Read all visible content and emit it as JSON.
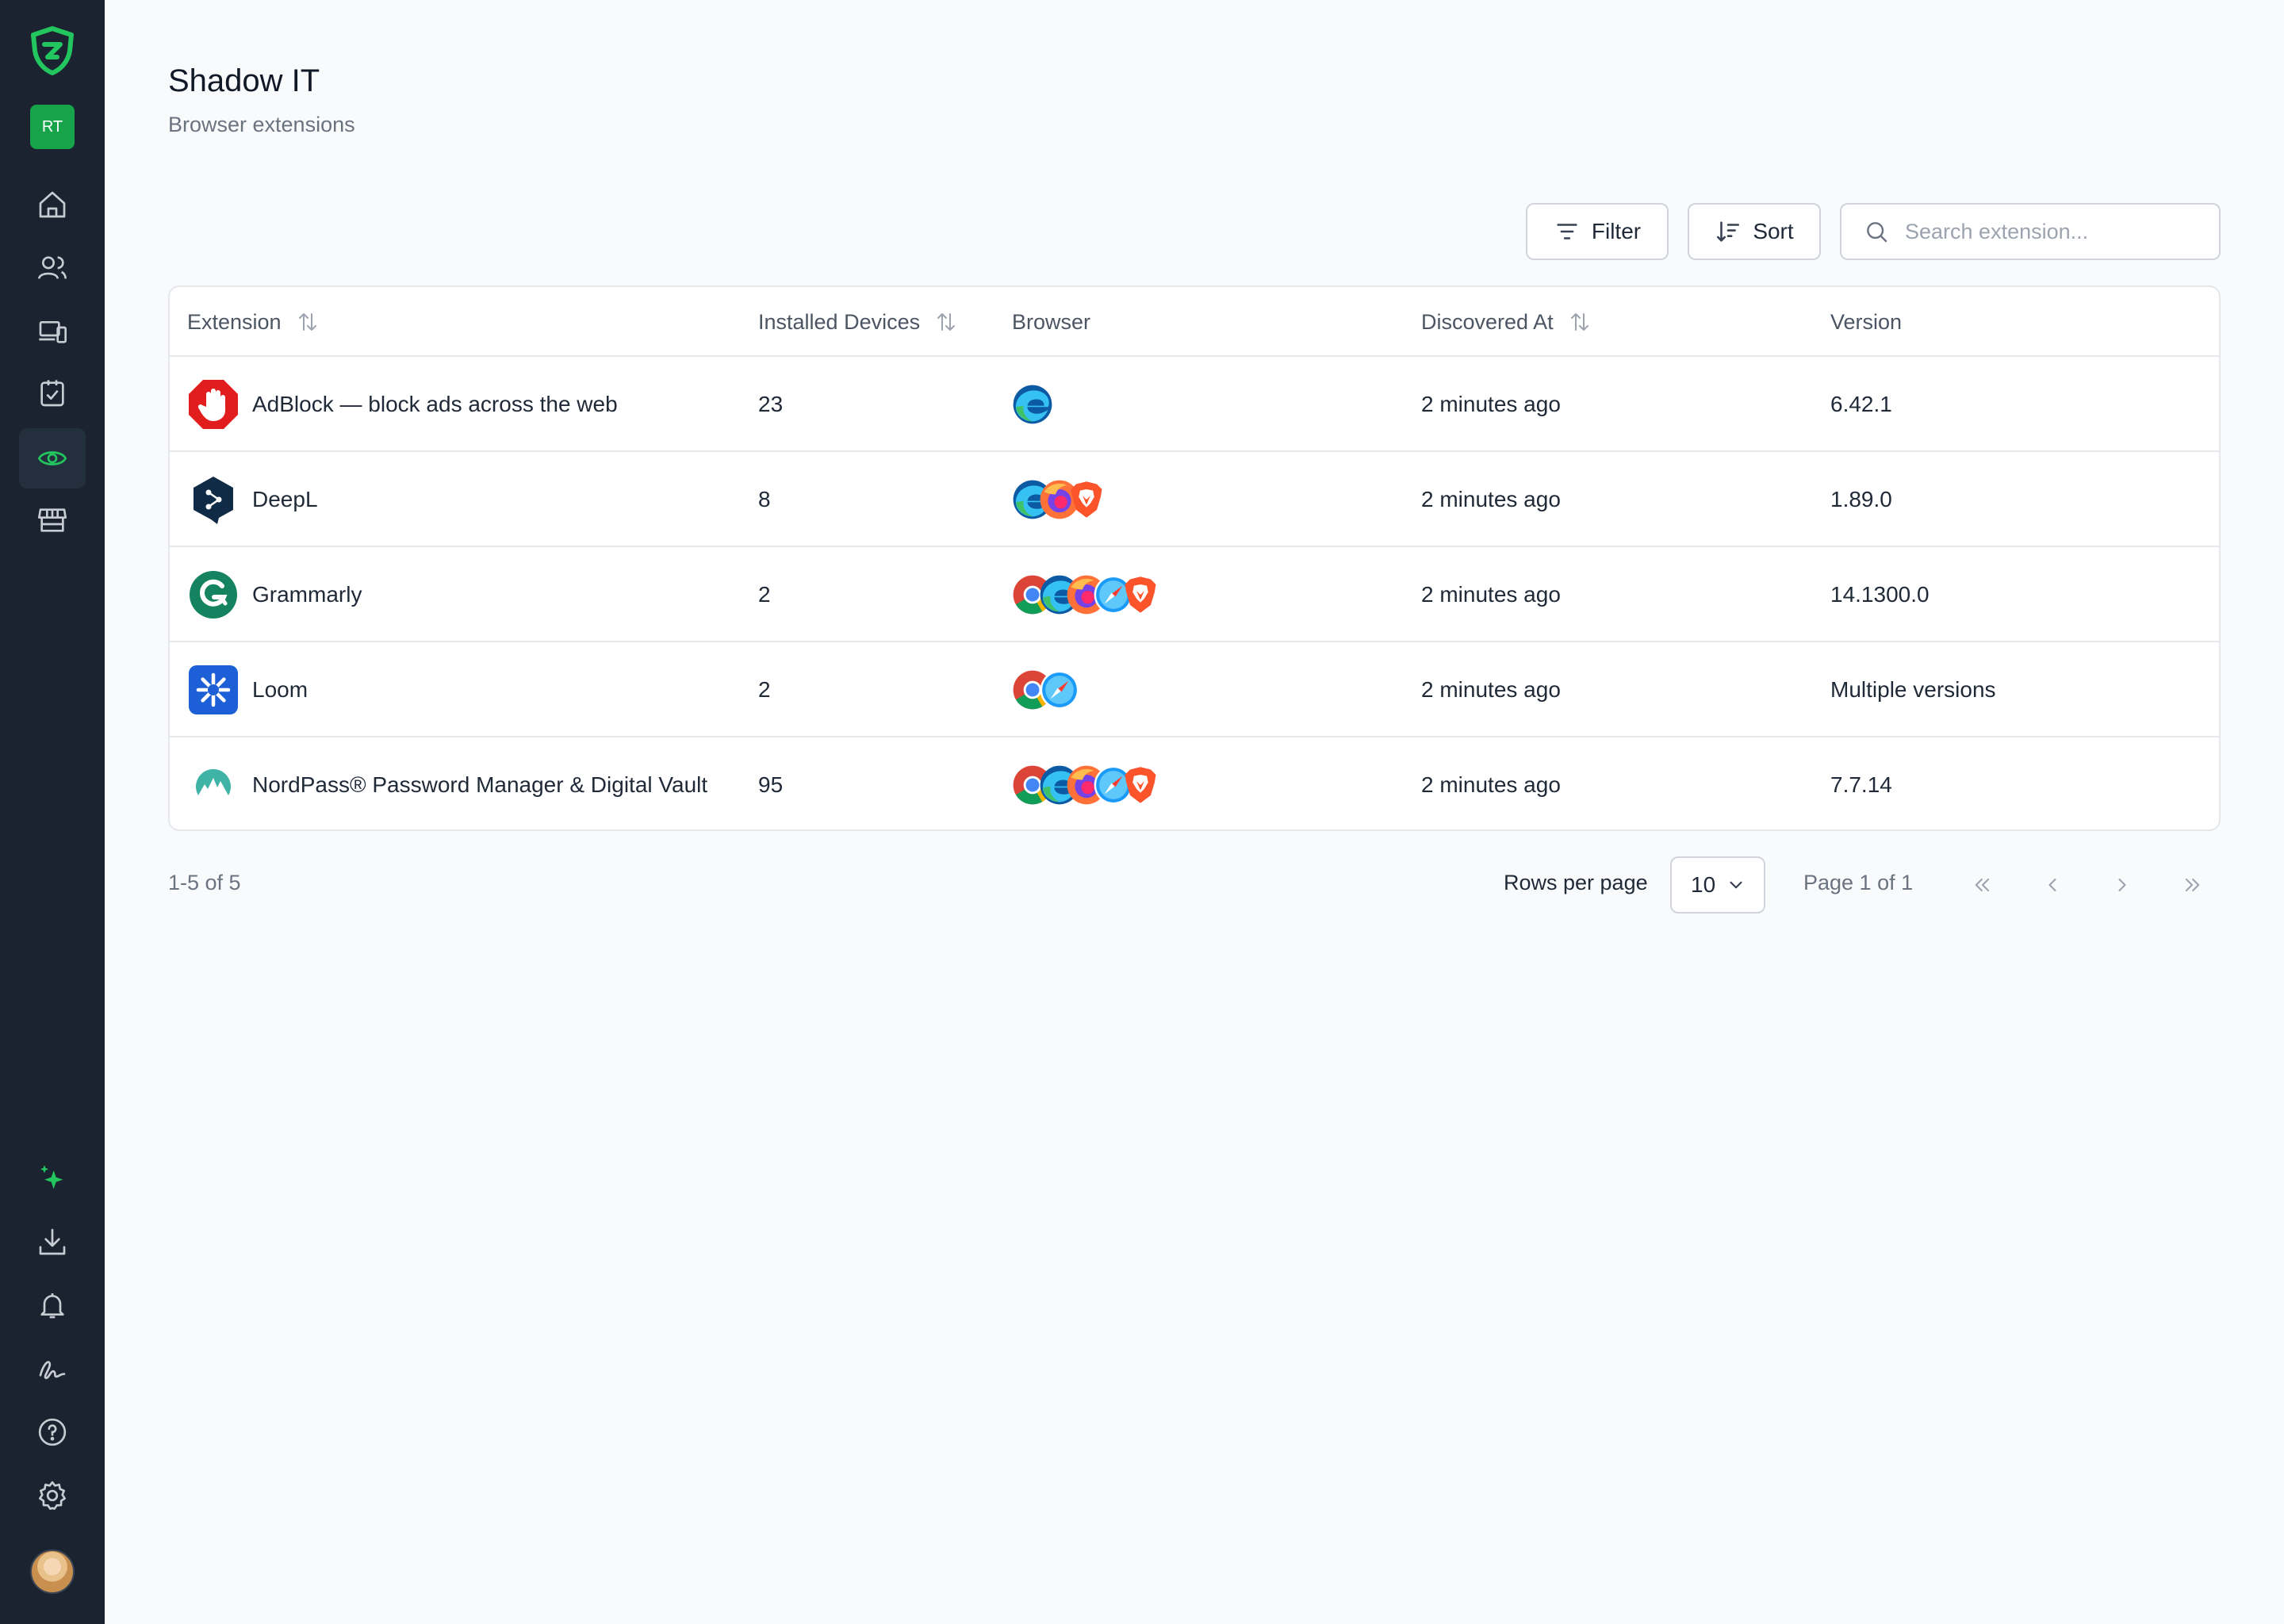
{
  "sidebar": {
    "workspace_badge": "RT",
    "nav": [
      "home-icon",
      "users-icon",
      "devices-icon",
      "clipboard-check-icon",
      "eye-icon",
      "store-icon"
    ],
    "bottom": [
      "sparkles-icon",
      "download-icon",
      "bell-icon",
      "signature-icon",
      "help-icon",
      "settings-icon"
    ],
    "active_item": "eye-icon",
    "accent_color": "#22c55e"
  },
  "header": {
    "title": "Shadow IT",
    "subtitle": "Browser extensions"
  },
  "toolbar": {
    "filter_label": "Filter",
    "sort_label": "Sort",
    "search_placeholder": "Search extension..."
  },
  "table": {
    "columns": [
      "Extension",
      "Installed Devices",
      "Browser",
      "Discovered At",
      "Version"
    ],
    "sortable_columns": [
      "Extension",
      "Installed Devices",
      "Discovered At"
    ],
    "rows": [
      {
        "icon": "adblock-icon",
        "extension": "AdBlock — block ads across the web",
        "devices": "23",
        "browsers": [
          "edge"
        ],
        "discovered": "2 minutes ago",
        "version": "6.42.1"
      },
      {
        "icon": "deepl-icon",
        "extension": "DeepL",
        "devices": "8",
        "browsers": [
          "edge",
          "firefox",
          "brave"
        ],
        "discovered": "2 minutes ago",
        "version": "1.89.0"
      },
      {
        "icon": "grammarly-icon",
        "extension": "Grammarly",
        "devices": "2",
        "browsers": [
          "chrome",
          "edge",
          "firefox",
          "safari",
          "brave"
        ],
        "discovered": "2 minutes ago",
        "version": "14.1300.0"
      },
      {
        "icon": "loom-icon",
        "extension": "Loom",
        "devices": "2",
        "browsers": [
          "chrome",
          "safari"
        ],
        "discovered": "2 minutes ago",
        "version": "Multiple versions"
      },
      {
        "icon": "nordpass-icon",
        "extension": "NordPass® Password Manager & Digital Vault",
        "devices": "95",
        "browsers": [
          "chrome",
          "edge",
          "firefox",
          "safari",
          "brave"
        ],
        "discovered": "2 minutes ago",
        "version": "7.7.14"
      }
    ]
  },
  "pagination": {
    "count_text": "1-5 of 5",
    "rows_per_page_label": "Rows per page",
    "rows_per_page_value": "10",
    "page_text": "Page 1 of 1"
  }
}
